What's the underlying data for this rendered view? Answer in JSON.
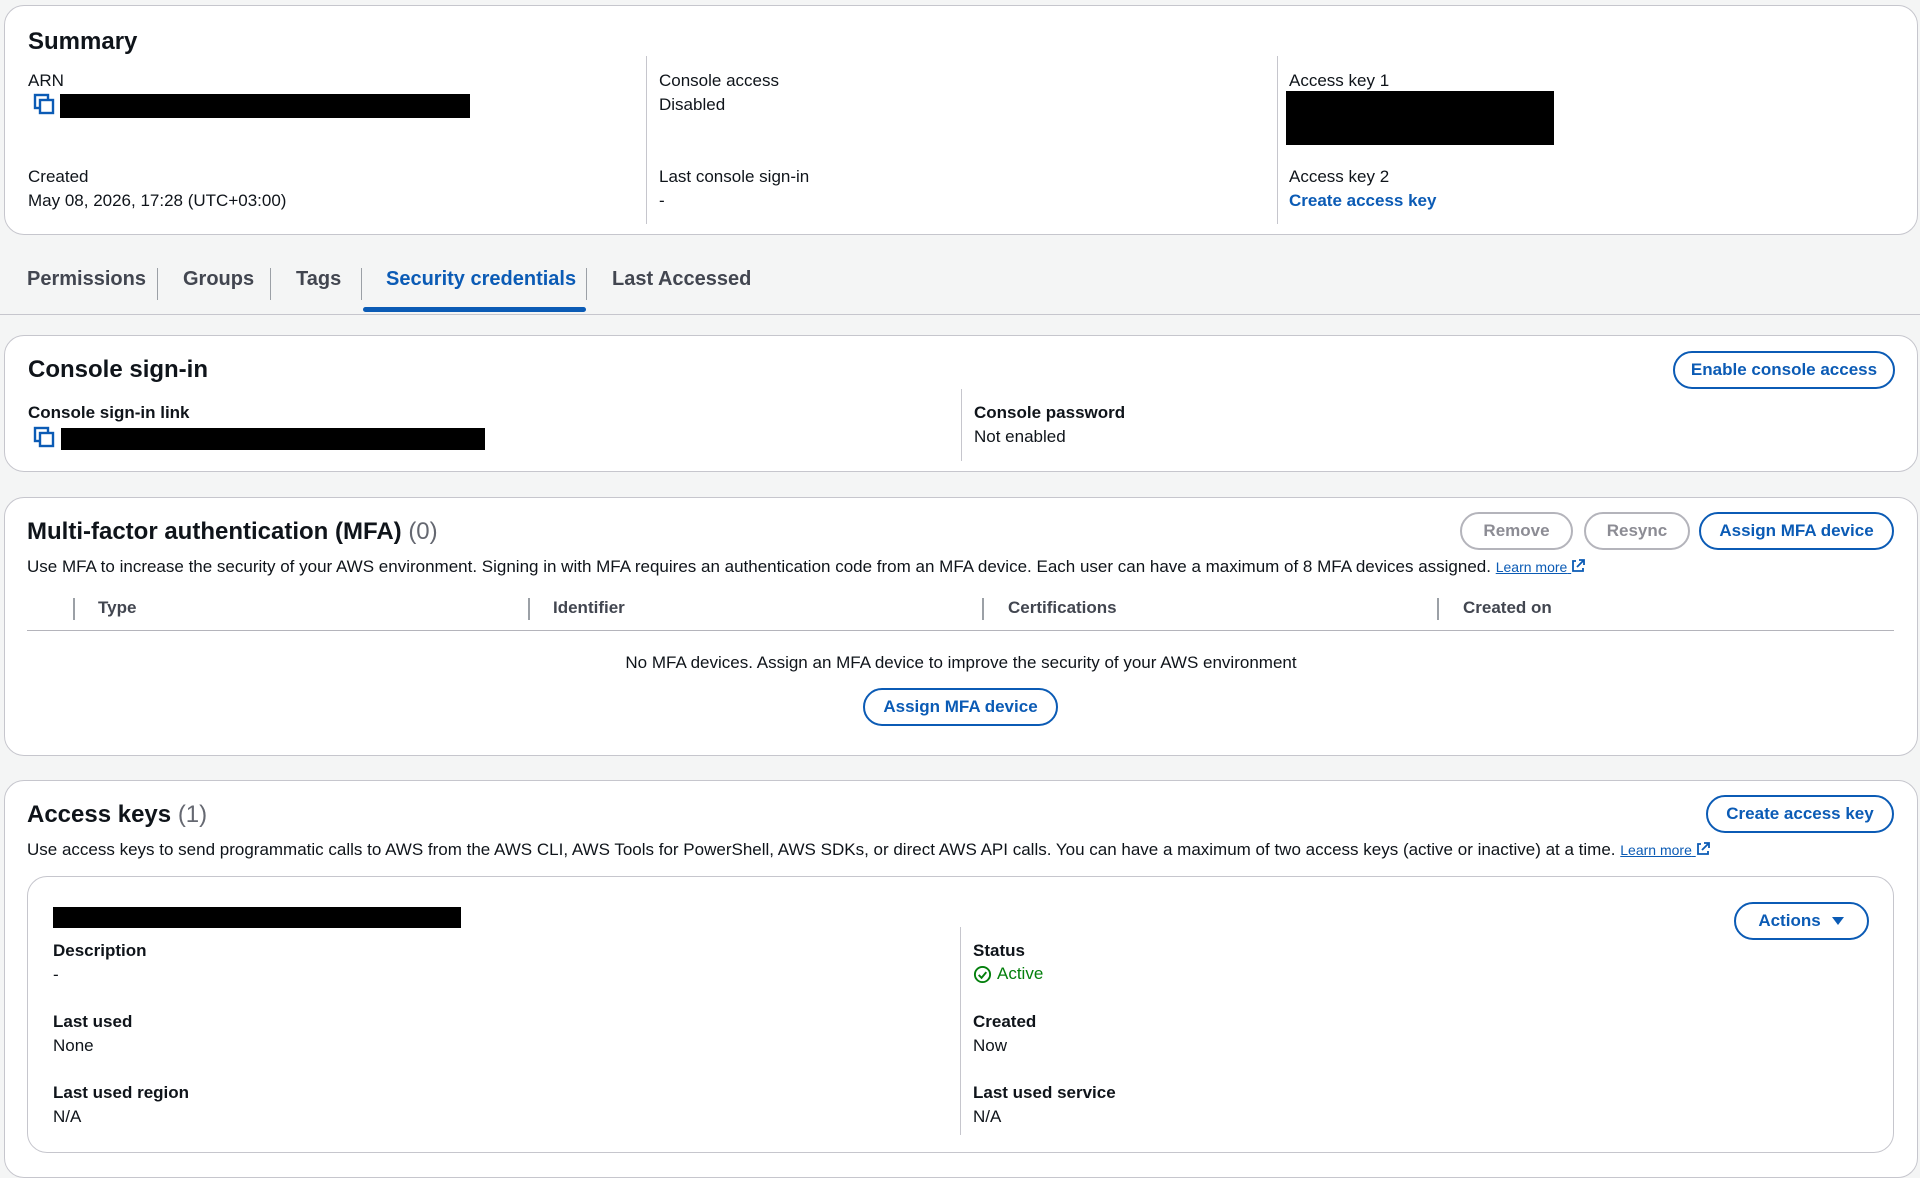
{
  "summary": {
    "title": "Summary",
    "arn_label": "ARN",
    "created_label": "Created",
    "created_value": "May 08, 2026, 17:28 (UTC+03:00)",
    "console_access_label": "Console access",
    "console_access_value": "Disabled",
    "last_signin_label": "Last console sign-in",
    "last_signin_value": "-",
    "access_key1_label": "Access key 1",
    "access_key2_label": "Access key 2",
    "create_access_key_link": "Create access key"
  },
  "tabs": [
    {
      "label": "Permissions"
    },
    {
      "label": "Groups"
    },
    {
      "label": "Tags"
    },
    {
      "label": "Security credentials",
      "active": true
    },
    {
      "label": "Last Accessed"
    }
  ],
  "console_signin": {
    "title": "Console sign-in",
    "enable_button": "Enable console access",
    "link_label": "Console sign-in link",
    "password_label": "Console password",
    "password_value": "Not enabled"
  },
  "mfa": {
    "title": "Multi-factor authentication (MFA)",
    "count": "(0)",
    "remove_button": "Remove",
    "resync_button": "Resync",
    "assign_button": "Assign MFA device",
    "description": "Use MFA to increase the security of your AWS environment. Signing in with MFA requires an authentication code from an MFA device. Each user can have a maximum of 8 MFA devices assigned.",
    "learn_more": "Learn more",
    "columns": [
      "Type",
      "Identifier",
      "Certifications",
      "Created on"
    ],
    "empty_message": "No MFA devices. Assign an MFA device to improve the security of your AWS environment",
    "empty_assign_button": "Assign MFA device"
  },
  "access_keys": {
    "title": "Access keys",
    "count": "(1)",
    "create_button": "Create access key",
    "description": "Use access keys to send programmatic calls to AWS from the AWS CLI, AWS Tools for PowerShell, AWS SDKs, or direct AWS API calls. You can have a maximum of two access keys (active or inactive) at a time.",
    "learn_more": "Learn more",
    "actions_button": "Actions",
    "key": {
      "description_label": "Description",
      "description_value": "-",
      "last_used_label": "Last used",
      "last_used_value": "None",
      "last_used_region_label": "Last used region",
      "last_used_region_value": "N/A",
      "status_label": "Status",
      "status_value": "Active",
      "created_label": "Created",
      "created_value": "Now",
      "last_used_service_label": "Last used service",
      "last_used_service_value": "N/A"
    }
  },
  "colors": {
    "link": "#0b5bb5",
    "success": "#037f0c",
    "border": "#c6c6cd",
    "page_bg": "#f4f5f5"
  },
  "icons": [
    "copy-icon",
    "external-link-icon",
    "check-circle-icon",
    "caret-down-icon"
  ]
}
